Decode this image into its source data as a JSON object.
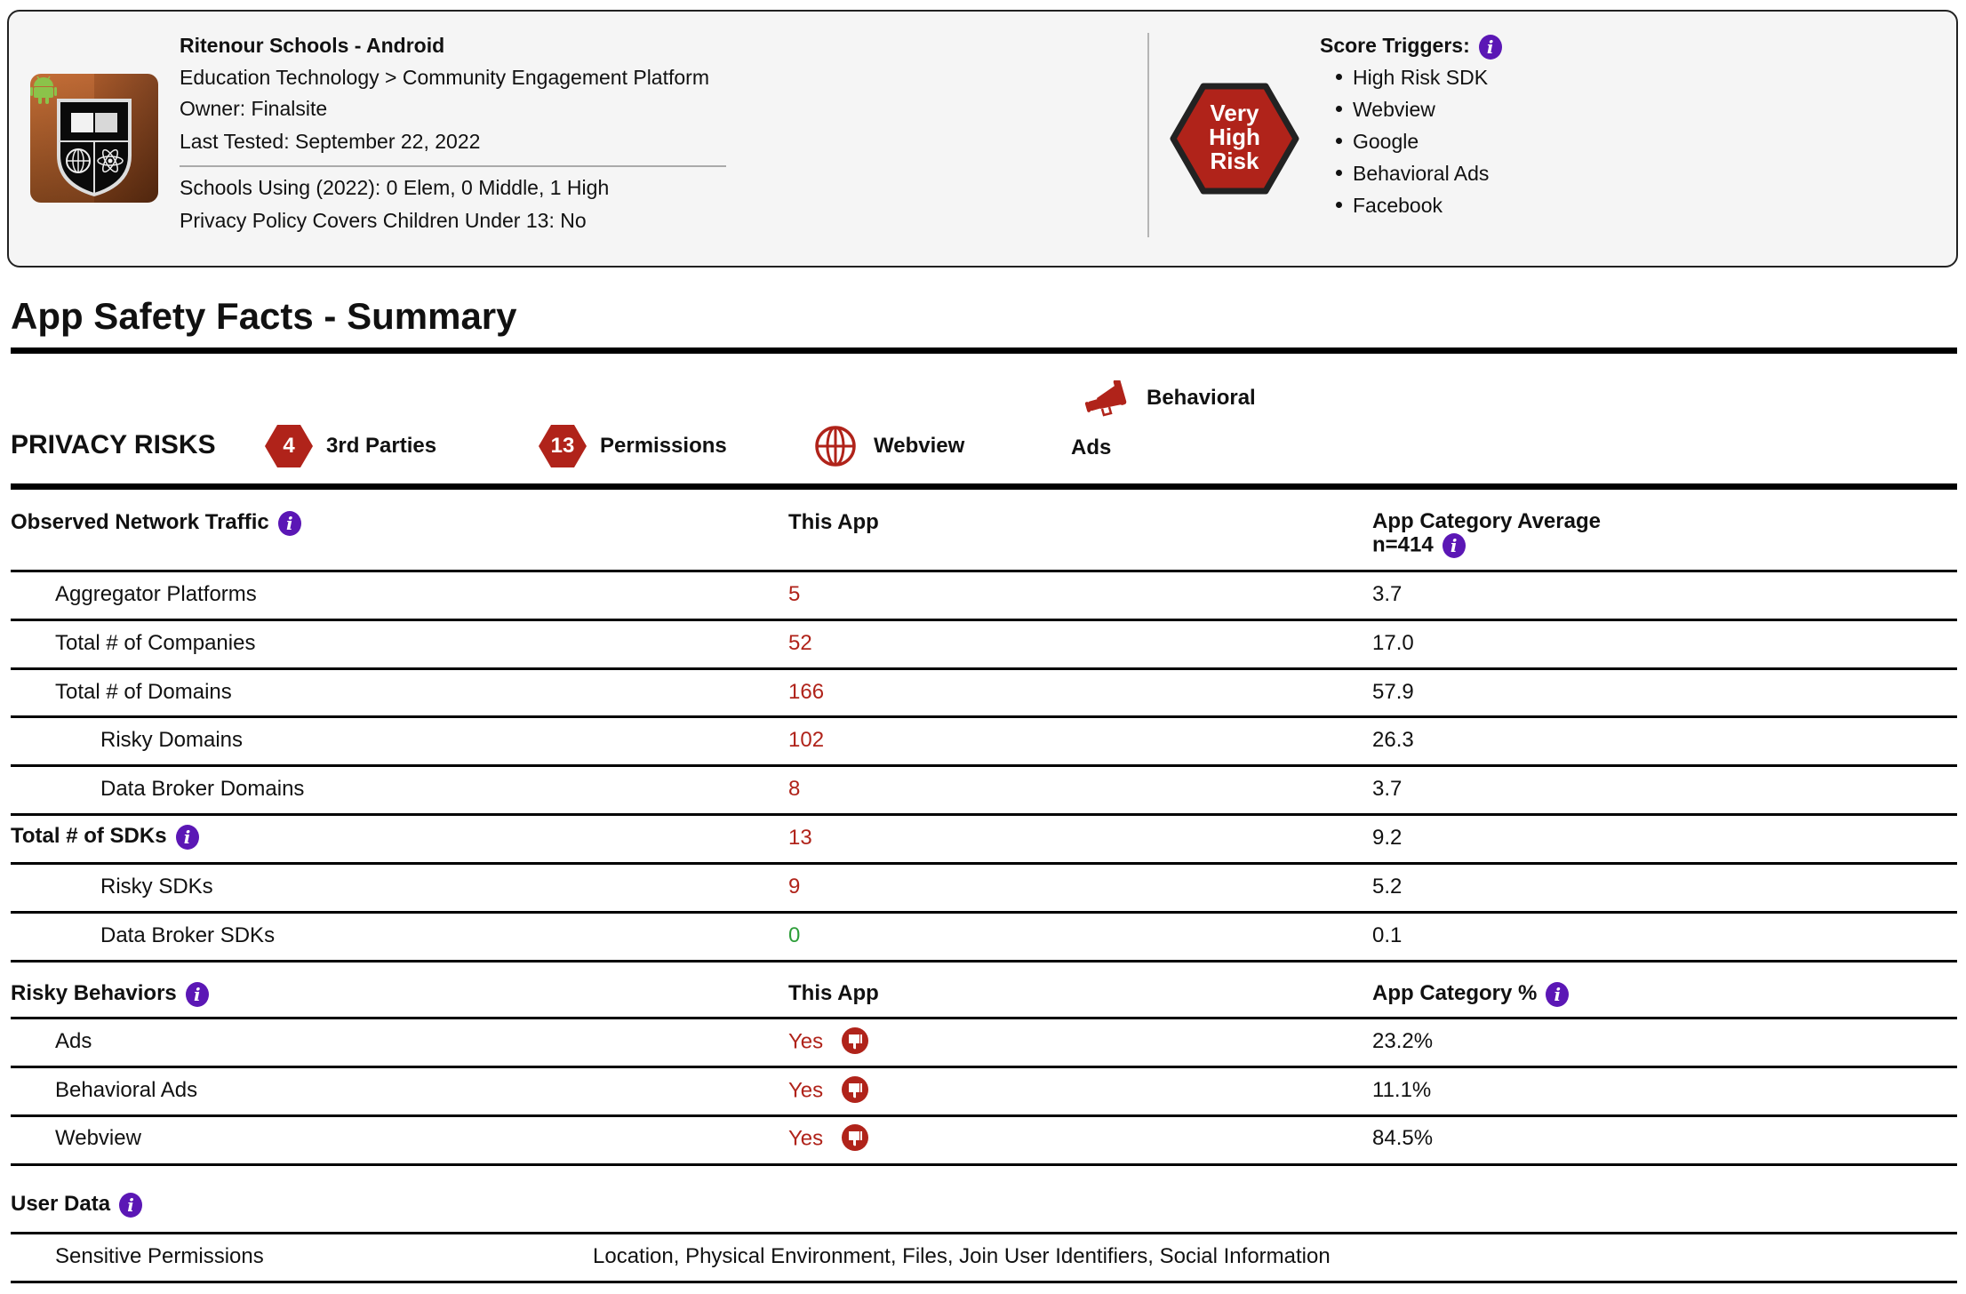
{
  "colors": {
    "accent_red": "#b0231a",
    "info_purple": "#5b17b5",
    "good_green": "#2e9e3a",
    "card_bg": "#f5f5f5"
  },
  "header": {
    "app_name": "Ritenour Schools - Android",
    "category": "Education Technology > Community Engagement Platform",
    "owner": "Owner: Finalsite",
    "last_tested": "Last Tested: September 22, 2022",
    "schools_using": "Schools Using (2022): 0 Elem, 0 Middle, 1 High",
    "privacy_policy": "Privacy Policy Covers Children Under 13: No",
    "app_icon": "school-shield-icon",
    "platform_icon": "android-icon",
    "risk_level": "Very High Risk",
    "risk_level_lines": [
      "Very",
      "High",
      "Risk"
    ],
    "score_triggers_title": "Score Triggers:",
    "score_triggers": [
      "High Risk SDK",
      "Webview",
      "Google",
      "Behavioral Ads",
      "Facebook"
    ]
  },
  "summary": {
    "title": "App Safety Facts - Summary",
    "privacy_risks_title": "PRIVACY RISKS",
    "privacy_risks": [
      {
        "icon": "hexagon-badge",
        "count": "4",
        "label": "3rd Parties"
      },
      {
        "icon": "hexagon-badge",
        "count": "13",
        "label": "Permissions"
      },
      {
        "icon": "globe-icon",
        "label": "Webview"
      },
      {
        "icon": "megaphone-icon",
        "label_line1": "Behavioral",
        "label_line2": "Ads"
      }
    ]
  },
  "network": {
    "header": {
      "col1": "Observed Network Traffic",
      "col2": "This App",
      "col3_line1": "App Category Average",
      "col3_line2": "n=414"
    },
    "rows": [
      {
        "label": "Aggregator Platforms",
        "this_app": "5",
        "avg": "3.7"
      },
      {
        "label": "Total # of Companies",
        "this_app": "52",
        "avg": "17.0"
      },
      {
        "label": "Total # of Domains",
        "this_app": "166",
        "avg": "57.9"
      },
      {
        "label": "Risky Domains",
        "this_app": "102",
        "avg": "26.3"
      },
      {
        "label": "Data Broker Domains",
        "this_app": "8",
        "avg": "3.7"
      },
      {
        "label": "Total # of SDKs",
        "this_app": "13",
        "avg": "9.2"
      },
      {
        "label": "Risky SDKs",
        "this_app": "9",
        "avg": "5.2"
      },
      {
        "label": "Data Broker SDKs",
        "this_app": "0",
        "avg": "0.1"
      }
    ]
  },
  "behaviors": {
    "header": {
      "col1": "Risky Behaviors",
      "col2": "This App",
      "col3": "App Category %"
    },
    "rows": [
      {
        "label": "Ads",
        "this_app": "Yes",
        "pct": "23.2%"
      },
      {
        "label": "Behavioral Ads",
        "this_app": "Yes",
        "pct": "11.1%"
      },
      {
        "label": "Webview",
        "this_app": "Yes",
        "pct": "84.5%"
      }
    ]
  },
  "user_data": {
    "title": "User Data",
    "rows": [
      {
        "label": "Sensitive Permissions",
        "value": "Location, Physical Environment, Files, Join User Identifiers, Social Information"
      }
    ]
  },
  "info_glyph": "i"
}
